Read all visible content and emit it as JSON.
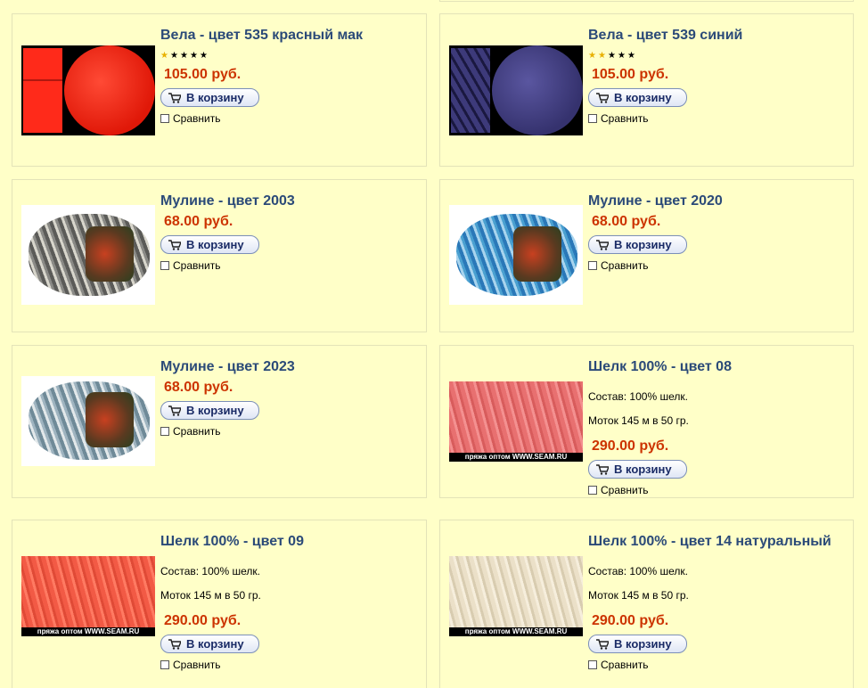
{
  "products": [
    {
      "title": "Вела - цвет 535 красный мак",
      "price": "105.00 руб.",
      "rating": 1,
      "cart": "В корзину",
      "compare": "Сравнить",
      "color": "#ff2a1a"
    },
    {
      "title": "Вела - цвет 539 синий",
      "price": "105.00 руб.",
      "rating": 2,
      "cart": "В корзину",
      "compare": "Сравнить",
      "color": "#3d3a7a"
    },
    {
      "title": "Мулине - цвет 2003",
      "price": "68.00 руб.",
      "cart": "В корзину",
      "compare": "Сравнить",
      "color": "#8a8a86"
    },
    {
      "title": "Мулине - цвет 2020",
      "price": "68.00 руб.",
      "cart": "В корзину",
      "compare": "Сравнить",
      "color": "#4aa0d0"
    },
    {
      "title": "Мулине - цвет 2023",
      "price": "68.00 руб.",
      "cart": "В корзину",
      "compare": "Сравнить",
      "color": "#9fb4c0"
    },
    {
      "title": "Шелк 100% - цвет 08",
      "composition": "Состав: 100% шелк.",
      "skein": "Моток 145 м в 50 гр.",
      "price": "290.00 руб.",
      "cart": "В корзину",
      "compare": "Сравнить",
      "color": "#e87070",
      "watermark": "пряжа оптом WWW.SEAM.RU"
    },
    {
      "title": "Шелк 100% - цвет 09",
      "composition": "Состав: 100% шелк.",
      "skein": "Моток 145 м в 50 гр.",
      "price": "290.00 руб.",
      "cart": "В корзину",
      "compare": "Сравнить",
      "color": "#f25a45",
      "watermark": "пряжа оптом WWW.SEAM.RU"
    },
    {
      "title": "Шелк 100% - цвет 14 натуральный",
      "composition": "Состав: 100% шелк.",
      "skein": "Моток 145 м в 50 гр.",
      "price": "290.00 руб.",
      "cart": "В корзину",
      "compare": "Сравнить",
      "color": "#ebe0c8",
      "watermark": "пряжа оптом WWW.SEAM.RU"
    }
  ],
  "colors": {
    "title": "#2b4a78",
    "price": "#cc3300",
    "background": "#ffffc8",
    "border": "#e3e3b8"
  }
}
